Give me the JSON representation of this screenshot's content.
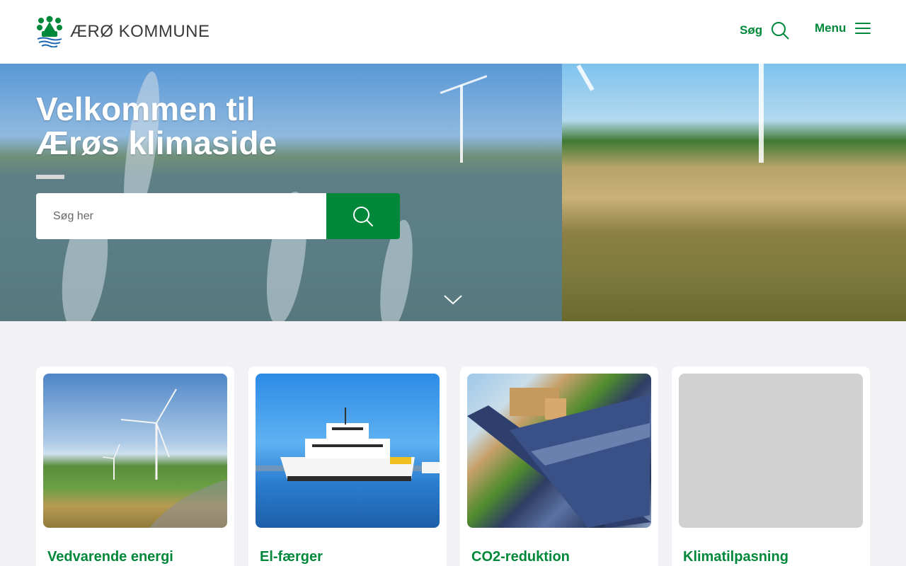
{
  "header": {
    "logo_text": "ÆRØ KOMMUNE",
    "search_label": "Søg",
    "menu_label": "Menu"
  },
  "hero": {
    "title_line1": "Velkommen til",
    "title_line2": "Ærøs klimaside",
    "search_placeholder": "Søg her"
  },
  "cards": [
    {
      "title": "Vedvarende energi",
      "image": "wind-turbines-field"
    },
    {
      "title": "El-færger",
      "image": "electric-ferry"
    },
    {
      "title": "CO2-reduktion",
      "image": "solar-panels"
    },
    {
      "title": "Klimatilpasning",
      "image": "placeholder-grey"
    }
  ],
  "colors": {
    "brand_green": "#00883a",
    "page_bg": "#f1f1f6",
    "header_bg": "#ffffff"
  },
  "icons": {
    "search": "search-icon",
    "menu": "hamburger-icon",
    "scroll": "chevron-down-icon"
  }
}
